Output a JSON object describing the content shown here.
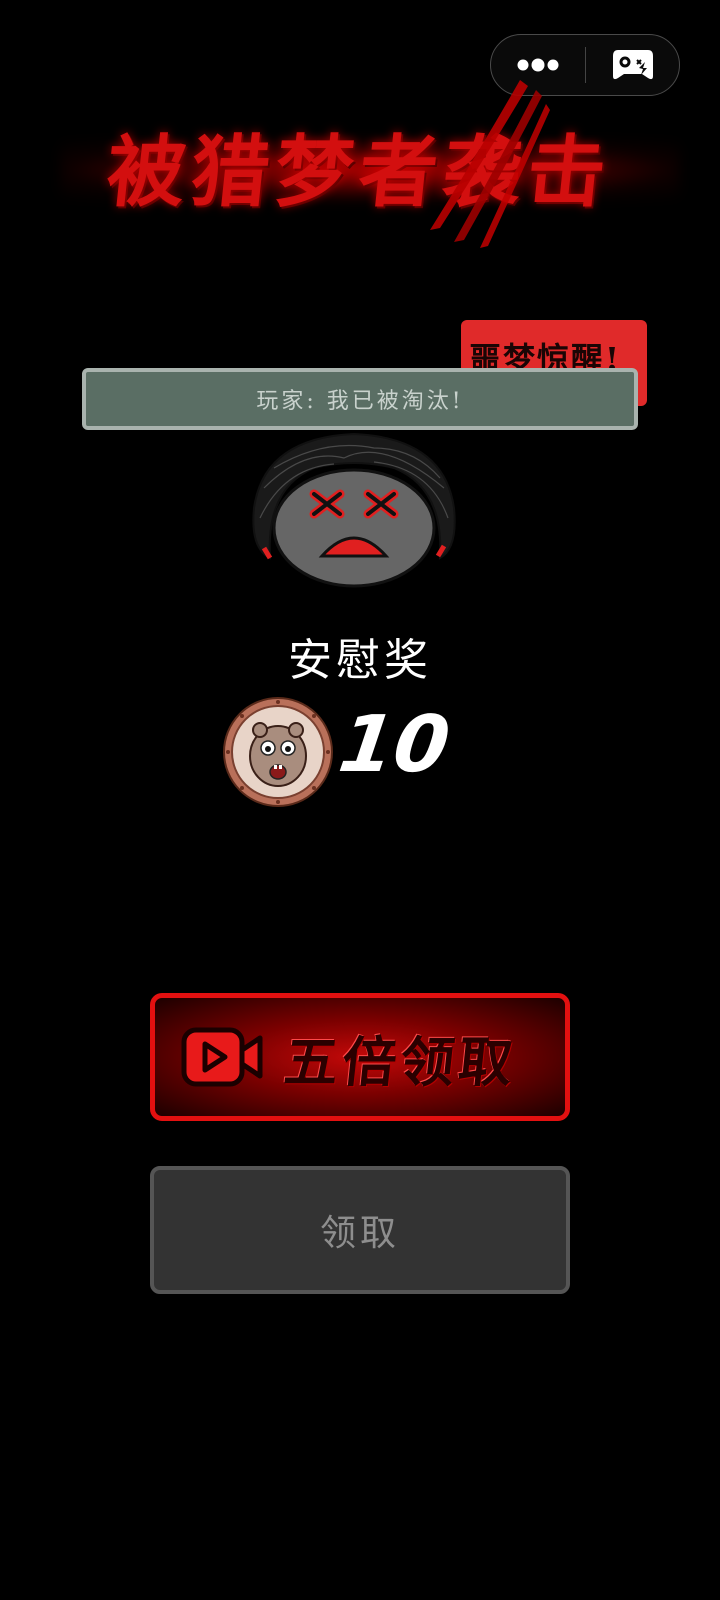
{
  "capsule": {
    "more_icon": "more-dots-icon",
    "game_icon": "gamepad-icon"
  },
  "header": {
    "title": "被猎梦者袭击"
  },
  "stamp": {
    "text": "噩梦惊醒!"
  },
  "banner": {
    "text": "玩家:  我已被淘汰!"
  },
  "reward": {
    "title": "安慰奖",
    "coin_icon": "hamster-coin-icon",
    "amount": "10"
  },
  "buttons": {
    "five_times_label": "五倍领取",
    "five_times_icon": "video-camera-icon",
    "claim_label": "领取"
  },
  "colors": {
    "accent_red": "#e31010",
    "banner_bg": "#5a6e64",
    "claim_bg": "#333333"
  }
}
